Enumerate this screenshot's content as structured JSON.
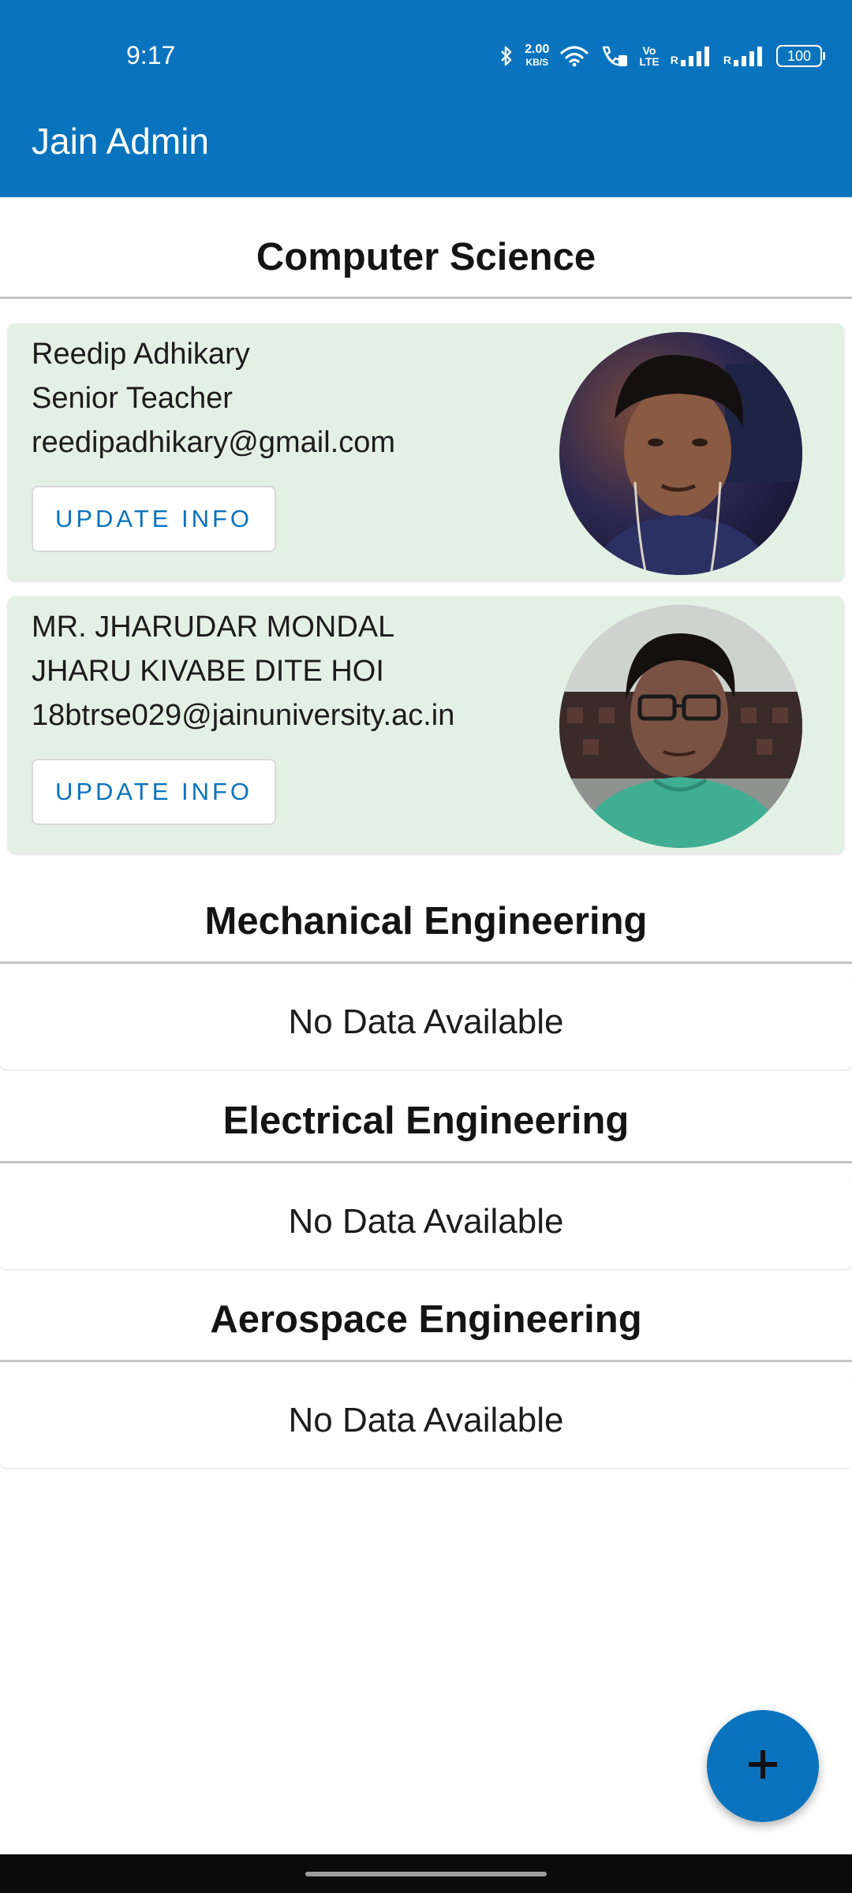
{
  "status_bar": {
    "time": "9:17",
    "net_speed": "2.00",
    "net_speed_unit": "KB/S",
    "volte_top": "Vo",
    "volte_bottom": "LTE",
    "signal_1_label": "R",
    "signal_2_label": "R",
    "battery": "100",
    "icons": [
      "bluetooth-icon",
      "wifi-icon",
      "wifi-calling-icon",
      "signal-icon",
      "signal-icon"
    ]
  },
  "app_bar": {
    "title": "Jain Admin"
  },
  "colors": {
    "primary": "#0a73bd",
    "card_background": "#e3f1e5",
    "divider": "#c4c4c4"
  },
  "sections": [
    {
      "title": "Computer Science",
      "members": [
        {
          "name": "Reedip Adhikary",
          "role": "Senior Teacher",
          "email": "reedipadhikary@gmail.com",
          "button_label": "UPDATE INFO"
        },
        {
          "name": "MR. JHARUDAR MONDAL",
          "role": "JHARU KIVABE DITE HOI",
          "email": "18btrse029@jainuniversity.ac.in",
          "button_label": "UPDATE INFO"
        }
      ]
    },
    {
      "title": "Mechanical Engineering",
      "empty_text": "No Data Available"
    },
    {
      "title": "Electrical Engineering",
      "empty_text": "No Data Available"
    },
    {
      "title": "Aerospace Engineering",
      "empty_text": "No Data Available"
    }
  ],
  "fab": {
    "icon": "plus-icon"
  }
}
